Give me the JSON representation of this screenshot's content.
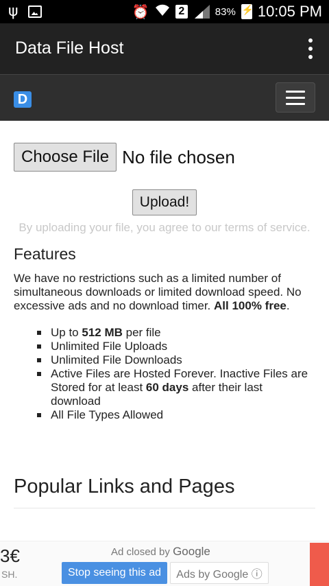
{
  "status_bar": {
    "battery_percent": "83%",
    "time": "10:05 PM",
    "sim_badge": "2",
    "icons": [
      "usb-icon",
      "image-icon",
      "alarm-icon",
      "wifi-icon",
      "signal-icon",
      "battery-charging-icon"
    ]
  },
  "app_bar": {
    "title": "Data File Host",
    "menu_icon": "overflow-menu-icon"
  },
  "site_nav": {
    "logo_letter": "D",
    "menu_icon": "hamburger-icon"
  },
  "upload": {
    "choose_file_label": "Choose File",
    "file_status": "No file chosen",
    "upload_label": "Upload!",
    "terms": "By uploading your file, you agree to our terms of service."
  },
  "features": {
    "heading": "Features",
    "paragraph": "We have no restrictions such as a limited number of simultaneous downloads or limited download speed. No excessive ads and no download timer.",
    "paragraph_bold": "All 100% free",
    "paragraph_end": ".",
    "items": [
      {
        "pre": "Up to ",
        "bold": "512 MB",
        "post": " per file"
      },
      {
        "pre": "Unlimited File Uploads",
        "bold": "",
        "post": ""
      },
      {
        "pre": "Unlimited File Downloads",
        "bold": "",
        "post": ""
      },
      {
        "pre": "Active Files are Hosted Forever. Inactive Files are Stored for at least ",
        "bold": "60 days",
        "post": " after their last download"
      },
      {
        "pre": "All File Types Allowed",
        "bold": "",
        "post": ""
      }
    ]
  },
  "popular": {
    "heading": "Popular Links and Pages"
  },
  "ad": {
    "left_number": "3€",
    "left_sub": "SH.",
    "closed_by": "Ad closed by",
    "closed_brand": "Google",
    "stop_label": "Stop seeing this ad",
    "ads_by_label": "Ads by Google ⓘ"
  },
  "colors": {
    "app_bar": "#222222",
    "site_nav": "#2f2f2f",
    "logo": "#3a8ee6",
    "stop_button": "#4a90e2",
    "ad_accent": "#ef5b4b"
  }
}
